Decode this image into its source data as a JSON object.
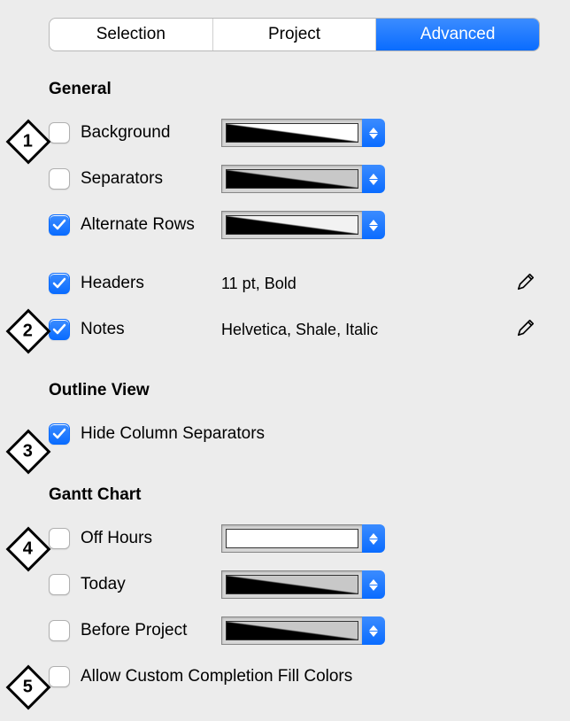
{
  "tabs": {
    "selection": "Selection",
    "project": "Project",
    "advanced": "Advanced"
  },
  "sections": {
    "general": {
      "title": "General",
      "background": {
        "label": "Background",
        "swatch_gradient": "linear-gradient(to top right, #000 0%, #000 48%, #fff 52%, #fff 100%)"
      },
      "separators": {
        "label": "Separators",
        "swatch_gradient": "linear-gradient(to top right, #000 0%, #000 48%, #c8c8c8 52%, #c8c8c8 100%)"
      },
      "alternate_rows": {
        "label": "Alternate Rows",
        "swatch_gradient": "linear-gradient(to top right, #000 0%, #000 48%, #f2f2f2 52%, #f2f2f2 100%)"
      },
      "headers": {
        "label": "Headers",
        "value": "11 pt, Bold"
      },
      "notes": {
        "label": "Notes",
        "value": "Helvetica, Shale, Italic"
      }
    },
    "outline": {
      "title": "Outline View",
      "hide_col_sep": {
        "label": "Hide Column Separators"
      }
    },
    "gantt": {
      "title": "Gantt Chart",
      "off_hours": {
        "label": "Off Hours",
        "swatch_gradient": "#ffffff"
      },
      "today": {
        "label": "Today",
        "swatch_gradient": "linear-gradient(to top right, #000 0%, #000 48%, #c8c8c8 52%, #c8c8c8 100%)"
      },
      "before_project": {
        "label": "Before Project",
        "swatch_gradient": "linear-gradient(to top right, #000 0%, #000 48%, #c8c8c8 52%, #c8c8c8 100%)"
      },
      "allow_custom": {
        "label": "Allow Custom Completion Fill Colors"
      }
    }
  },
  "callouts": {
    "c1": "1",
    "c2": "2",
    "c3": "3",
    "c4": "4",
    "c5": "5"
  }
}
